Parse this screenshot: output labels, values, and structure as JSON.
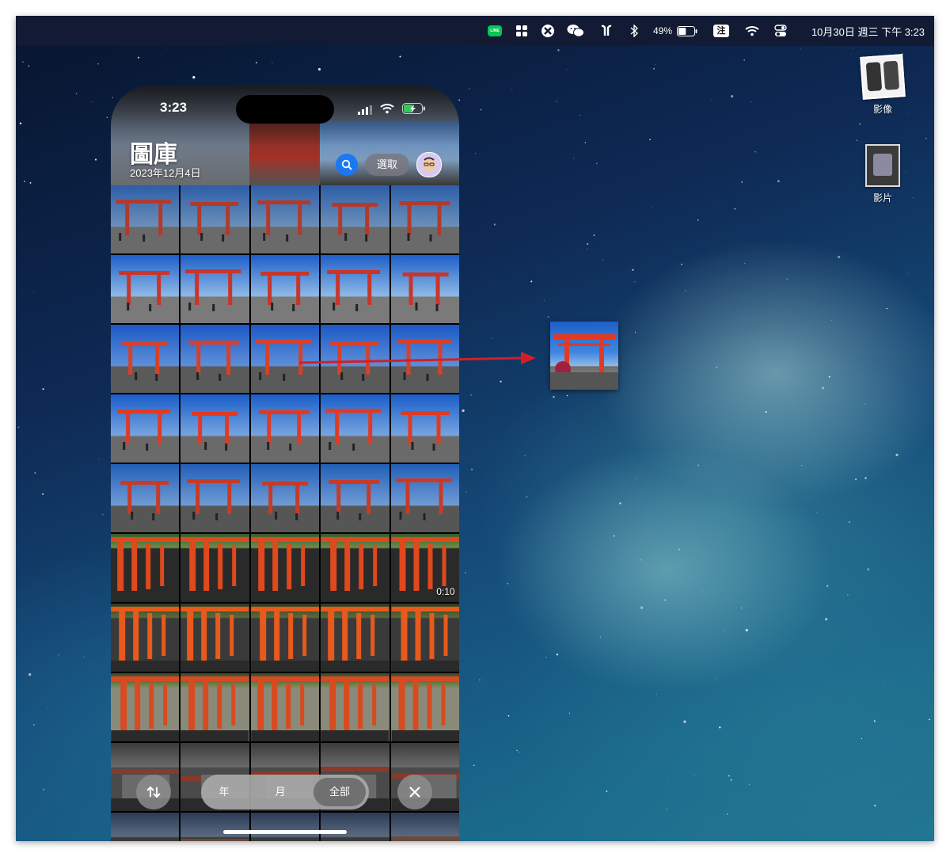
{
  "menubar": {
    "line_label": "LINE",
    "battery_percent": "49%",
    "input_method": "注",
    "clock": "10月30日 週三  下午 3:23",
    "battery_level": 0.49
  },
  "desktop_icons": [
    {
      "label": "影像",
      "icon": "image-file-icon"
    },
    {
      "label": "影片",
      "icon": "video-file-icon"
    }
  ],
  "phone": {
    "status_time": "3:23",
    "title": "圖庫",
    "date": "2023年12月4日",
    "select_label": "選取",
    "video_duration": "0:10",
    "toolbar": {
      "year": "年",
      "month": "月",
      "all": "全部"
    }
  },
  "colors": {
    "menubar_bg": "#121b33",
    "search_blue": "#1a78f2",
    "arrow_red": "#d21f26",
    "torii_red": "#e03a24",
    "line_green": "#06c755"
  },
  "annotation": {
    "type": "drag-arrow",
    "meaning": "photo dragged from phone library to desktop"
  }
}
